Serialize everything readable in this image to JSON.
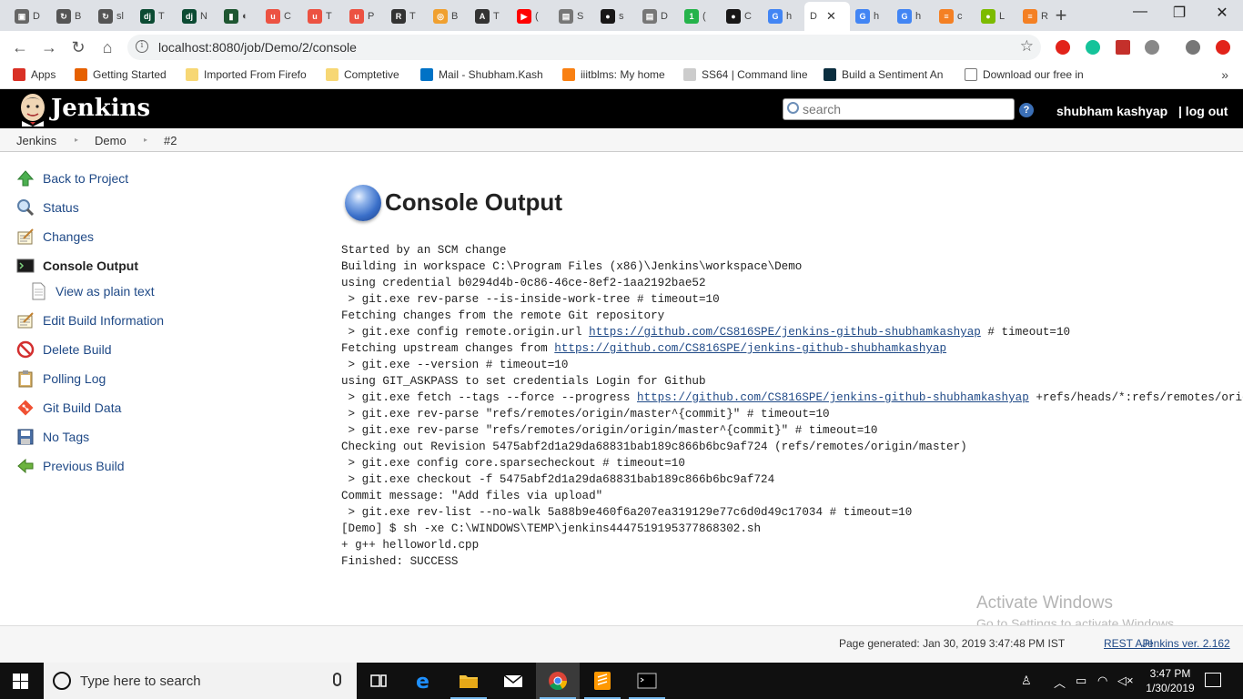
{
  "browser": {
    "tabs": [
      {
        "label": "D",
        "color": "#666666",
        "glyph": "▣"
      },
      {
        "label": "B",
        "color": "#555555",
        "glyph": "↻"
      },
      {
        "label": "sl",
        "color": "#555555",
        "glyph": "↻"
      },
      {
        "label": "T",
        "color": "#0c4b33",
        "glyph": "dj"
      },
      {
        "label": "N",
        "color": "#0c4b33",
        "glyph": "dj"
      },
      {
        "label": "◐",
        "color": "#1e5631",
        "glyph": "▮"
      },
      {
        "label": "C",
        "color": "#ec5242",
        "glyph": "u"
      },
      {
        "label": "T",
        "color": "#ec5242",
        "glyph": "u"
      },
      {
        "label": "P",
        "color": "#ec5242",
        "glyph": "u"
      },
      {
        "label": "T",
        "color": "#333333",
        "glyph": "R"
      },
      {
        "label": "B",
        "color": "#f0a030",
        "glyph": "◎"
      },
      {
        "label": "T",
        "color": "#333333",
        "glyph": "A"
      },
      {
        "label": "(",
        "color": "#ff0000",
        "glyph": "▶"
      },
      {
        "label": "S",
        "color": "#777777",
        "glyph": "▤"
      },
      {
        "label": "s",
        "color": "#181717",
        "glyph": "●"
      },
      {
        "label": "D",
        "color": "#777777",
        "glyph": "▤"
      },
      {
        "label": "(",
        "color": "#25b34b",
        "glyph": "1"
      },
      {
        "label": "C",
        "color": "#181717",
        "glyph": "●"
      },
      {
        "label": "h",
        "color": "#4285f4",
        "glyph": "G"
      },
      {
        "label": "D",
        "color": "#555555",
        "glyph": "",
        "active": true
      },
      {
        "label": "h",
        "color": "#4285f4",
        "glyph": "G"
      },
      {
        "label": "h",
        "color": "#4285f4",
        "glyph": "G"
      },
      {
        "label": "c",
        "color": "#f48024",
        "glyph": "≡"
      },
      {
        "label": "L",
        "color": "#7cbb00",
        "glyph": "●"
      },
      {
        "label": "R",
        "color": "#f48024",
        "glyph": "≡"
      }
    ],
    "active_tab_close": "✕",
    "new_tab": "+",
    "url": "localhost:8080/job/Demo/2/console",
    "bookmarks": [
      {
        "label": "Apps",
        "color": "#d93025"
      },
      {
        "label": "Getting Started",
        "color": "#e66000"
      },
      {
        "label": "Imported From Firefo",
        "color": "#f7d774"
      },
      {
        "label": "Comptetive",
        "color": "#f7d774"
      },
      {
        "label": "Mail - Shubham.Kash",
        "color": "#0072c6"
      },
      {
        "label": "iiitblms: My home",
        "color": "#f98012"
      },
      {
        "label": "SS64 | Command line",
        "color": "#cccccc"
      },
      {
        "label": "Build a Sentiment An",
        "color": "#0b2e3f"
      },
      {
        "label": "Download our free in",
        "color": "#ffffff"
      }
    ],
    "bookmarks_more": "»"
  },
  "jenkins": {
    "title": "Jenkins",
    "search_placeholder": "search",
    "help": "?",
    "user": "shubham kashyap",
    "logout": "| log out",
    "breadcrumb": [
      "Jenkins",
      "Demo",
      "#2"
    ],
    "side": [
      {
        "label": "Back to Project",
        "icon": "up-arrow-icon"
      },
      {
        "label": "Status",
        "icon": "magnifier-icon"
      },
      {
        "label": "Changes",
        "icon": "notepad-icon"
      },
      {
        "label": "Console Output",
        "icon": "terminal-icon",
        "current": true
      },
      {
        "label": "View as plain text",
        "icon": "document-icon"
      },
      {
        "label": "Edit Build Information",
        "icon": "notepad-icon"
      },
      {
        "label": "Delete Build",
        "icon": "no-entry-icon"
      },
      {
        "label": "Polling Log",
        "icon": "clipboard-icon"
      },
      {
        "label": "Git Build Data",
        "icon": "git-icon"
      },
      {
        "label": "No Tags",
        "icon": "floppy-disk-icon"
      },
      {
        "label": "Previous Build",
        "icon": "left-arrow-icon"
      }
    ],
    "console_title": "Console Output",
    "console_lines": [
      [
        {
          "t": "Started by an SCM change"
        }
      ],
      [
        {
          "t": "Building in workspace C:\\Program Files (x86)\\Jenkins\\workspace\\Demo"
        }
      ],
      [
        {
          "t": "using credential b0294d4b-0c86-46ce-8ef2-1aa2192bae52"
        }
      ],
      [
        {
          "t": " > git.exe rev-parse --is-inside-work-tree # timeout=10"
        }
      ],
      [
        {
          "t": "Fetching changes from the remote Git repository"
        }
      ],
      [
        {
          "t": " > git.exe config remote.origin.url "
        },
        {
          "t": "https://github.com/CS816SPE/jenkins-github-shubhamkashyap",
          "link": true
        },
        {
          "t": " # timeout=10"
        }
      ],
      [
        {
          "t": "Fetching upstream changes from "
        },
        {
          "t": "https://github.com/CS816SPE/jenkins-github-shubhamkashyap",
          "link": true
        }
      ],
      [
        {
          "t": " > git.exe --version # timeout=10"
        }
      ],
      [
        {
          "t": "using GIT_ASKPASS to set credentials Login for Github"
        }
      ],
      [
        {
          "t": " > git.exe fetch --tags --force --progress "
        },
        {
          "t": "https://github.com/CS816SPE/jenkins-github-shubhamkashyap",
          "link": true
        },
        {
          "t": " +refs/heads/*:refs/remotes/origin/*"
        }
      ],
      [
        {
          "t": " > git.exe rev-parse \"refs/remotes/origin/master^{commit}\" # timeout=10"
        }
      ],
      [
        {
          "t": " > git.exe rev-parse \"refs/remotes/origin/origin/master^{commit}\" # timeout=10"
        }
      ],
      [
        {
          "t": "Checking out Revision 5475abf2d1a29da68831bab189c866b6bc9af724 (refs/remotes/origin/master)"
        }
      ],
      [
        {
          "t": " > git.exe config core.sparsecheckout # timeout=10"
        }
      ],
      [
        {
          "t": " > git.exe checkout -f 5475abf2d1a29da68831bab189c866b6bc9af724"
        }
      ],
      [
        {
          "t": "Commit message: \"Add files via upload\""
        }
      ],
      [
        {
          "t": " > git.exe rev-list --no-walk 5a88b9e460f6a207ea319129e77c6d0d49c17034 # timeout=10"
        }
      ],
      [
        {
          "t": "[Demo] $ sh -xe C:\\WINDOWS\\TEMP\\jenkins4447519195377868302.sh"
        }
      ],
      [
        {
          "t": "+ g++ helloworld.cpp"
        }
      ],
      [
        {
          "t": "Finished: SUCCESS"
        }
      ]
    ],
    "footer": {
      "page_generated": "Page generated: Jan 30, 2019 3:47:48 PM IST",
      "rest_api": "REST API",
      "version": "Jenkins ver. 2.162"
    }
  },
  "watermark": {
    "line1": "Activate Windows",
    "line2": "Go to Settings to activate Windows."
  },
  "taskbar": {
    "search_placeholder": "Type here to search",
    "clock_time": "3:47 PM",
    "clock_date": "1/30/2019"
  }
}
